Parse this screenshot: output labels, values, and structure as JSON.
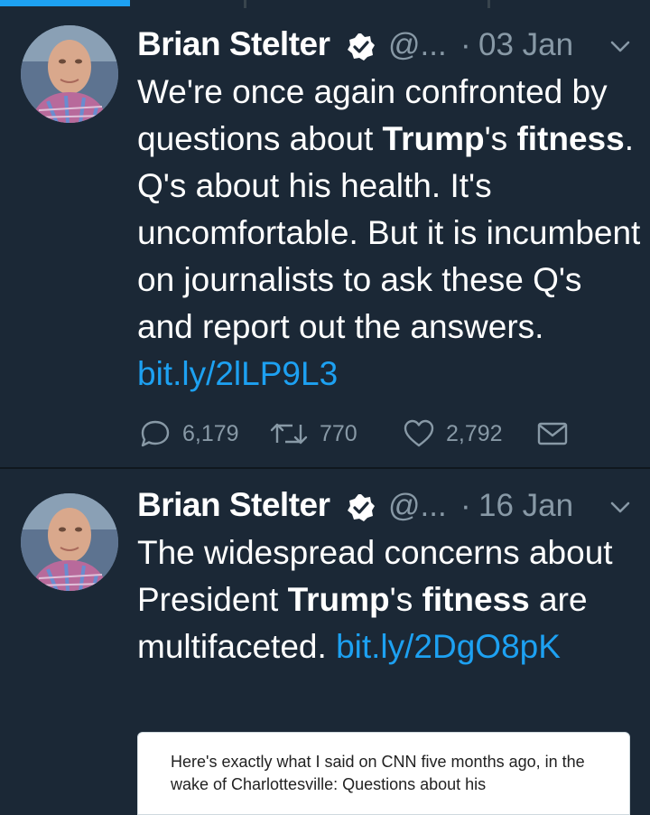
{
  "top_bar": {
    "accent": "#1da1f2"
  },
  "tweets": [
    {
      "author_name": "Brian Stelter",
      "handle": "@...",
      "separator": "·",
      "date": "03 Jan",
      "text_parts": [
        "We're once again confronted by questions about ",
        "Trump",
        "'s ",
        "fitness",
        ". Q's about his health. It's uncomfortable. But it is incumbent on journalists to ask these Q's and report out the answers. "
      ],
      "link": "bit.ly/2lLP9L3",
      "replies": "6,179",
      "retweets": "770",
      "likes": "2,792",
      "icons": [
        "reply-icon",
        "retweet-icon",
        "like-icon",
        "direct-message-icon"
      ]
    },
    {
      "author_name": "Brian Stelter",
      "handle": "@...",
      "separator": "·",
      "date": "16 Jan",
      "text_parts": [
        "The widespread concerns about President ",
        "Trump",
        "'s ",
        "fitness",
        " are multifaceted. "
      ],
      "link": "bit.ly/2DgO8pK",
      "card_text": "Here's exactly what I said on CNN five months ago, in the wake of Charlottesville: Questions about his"
    }
  ],
  "colors": {
    "background": "#1b2836",
    "secondary_text": "#8899a6",
    "link": "#1da1f2"
  }
}
